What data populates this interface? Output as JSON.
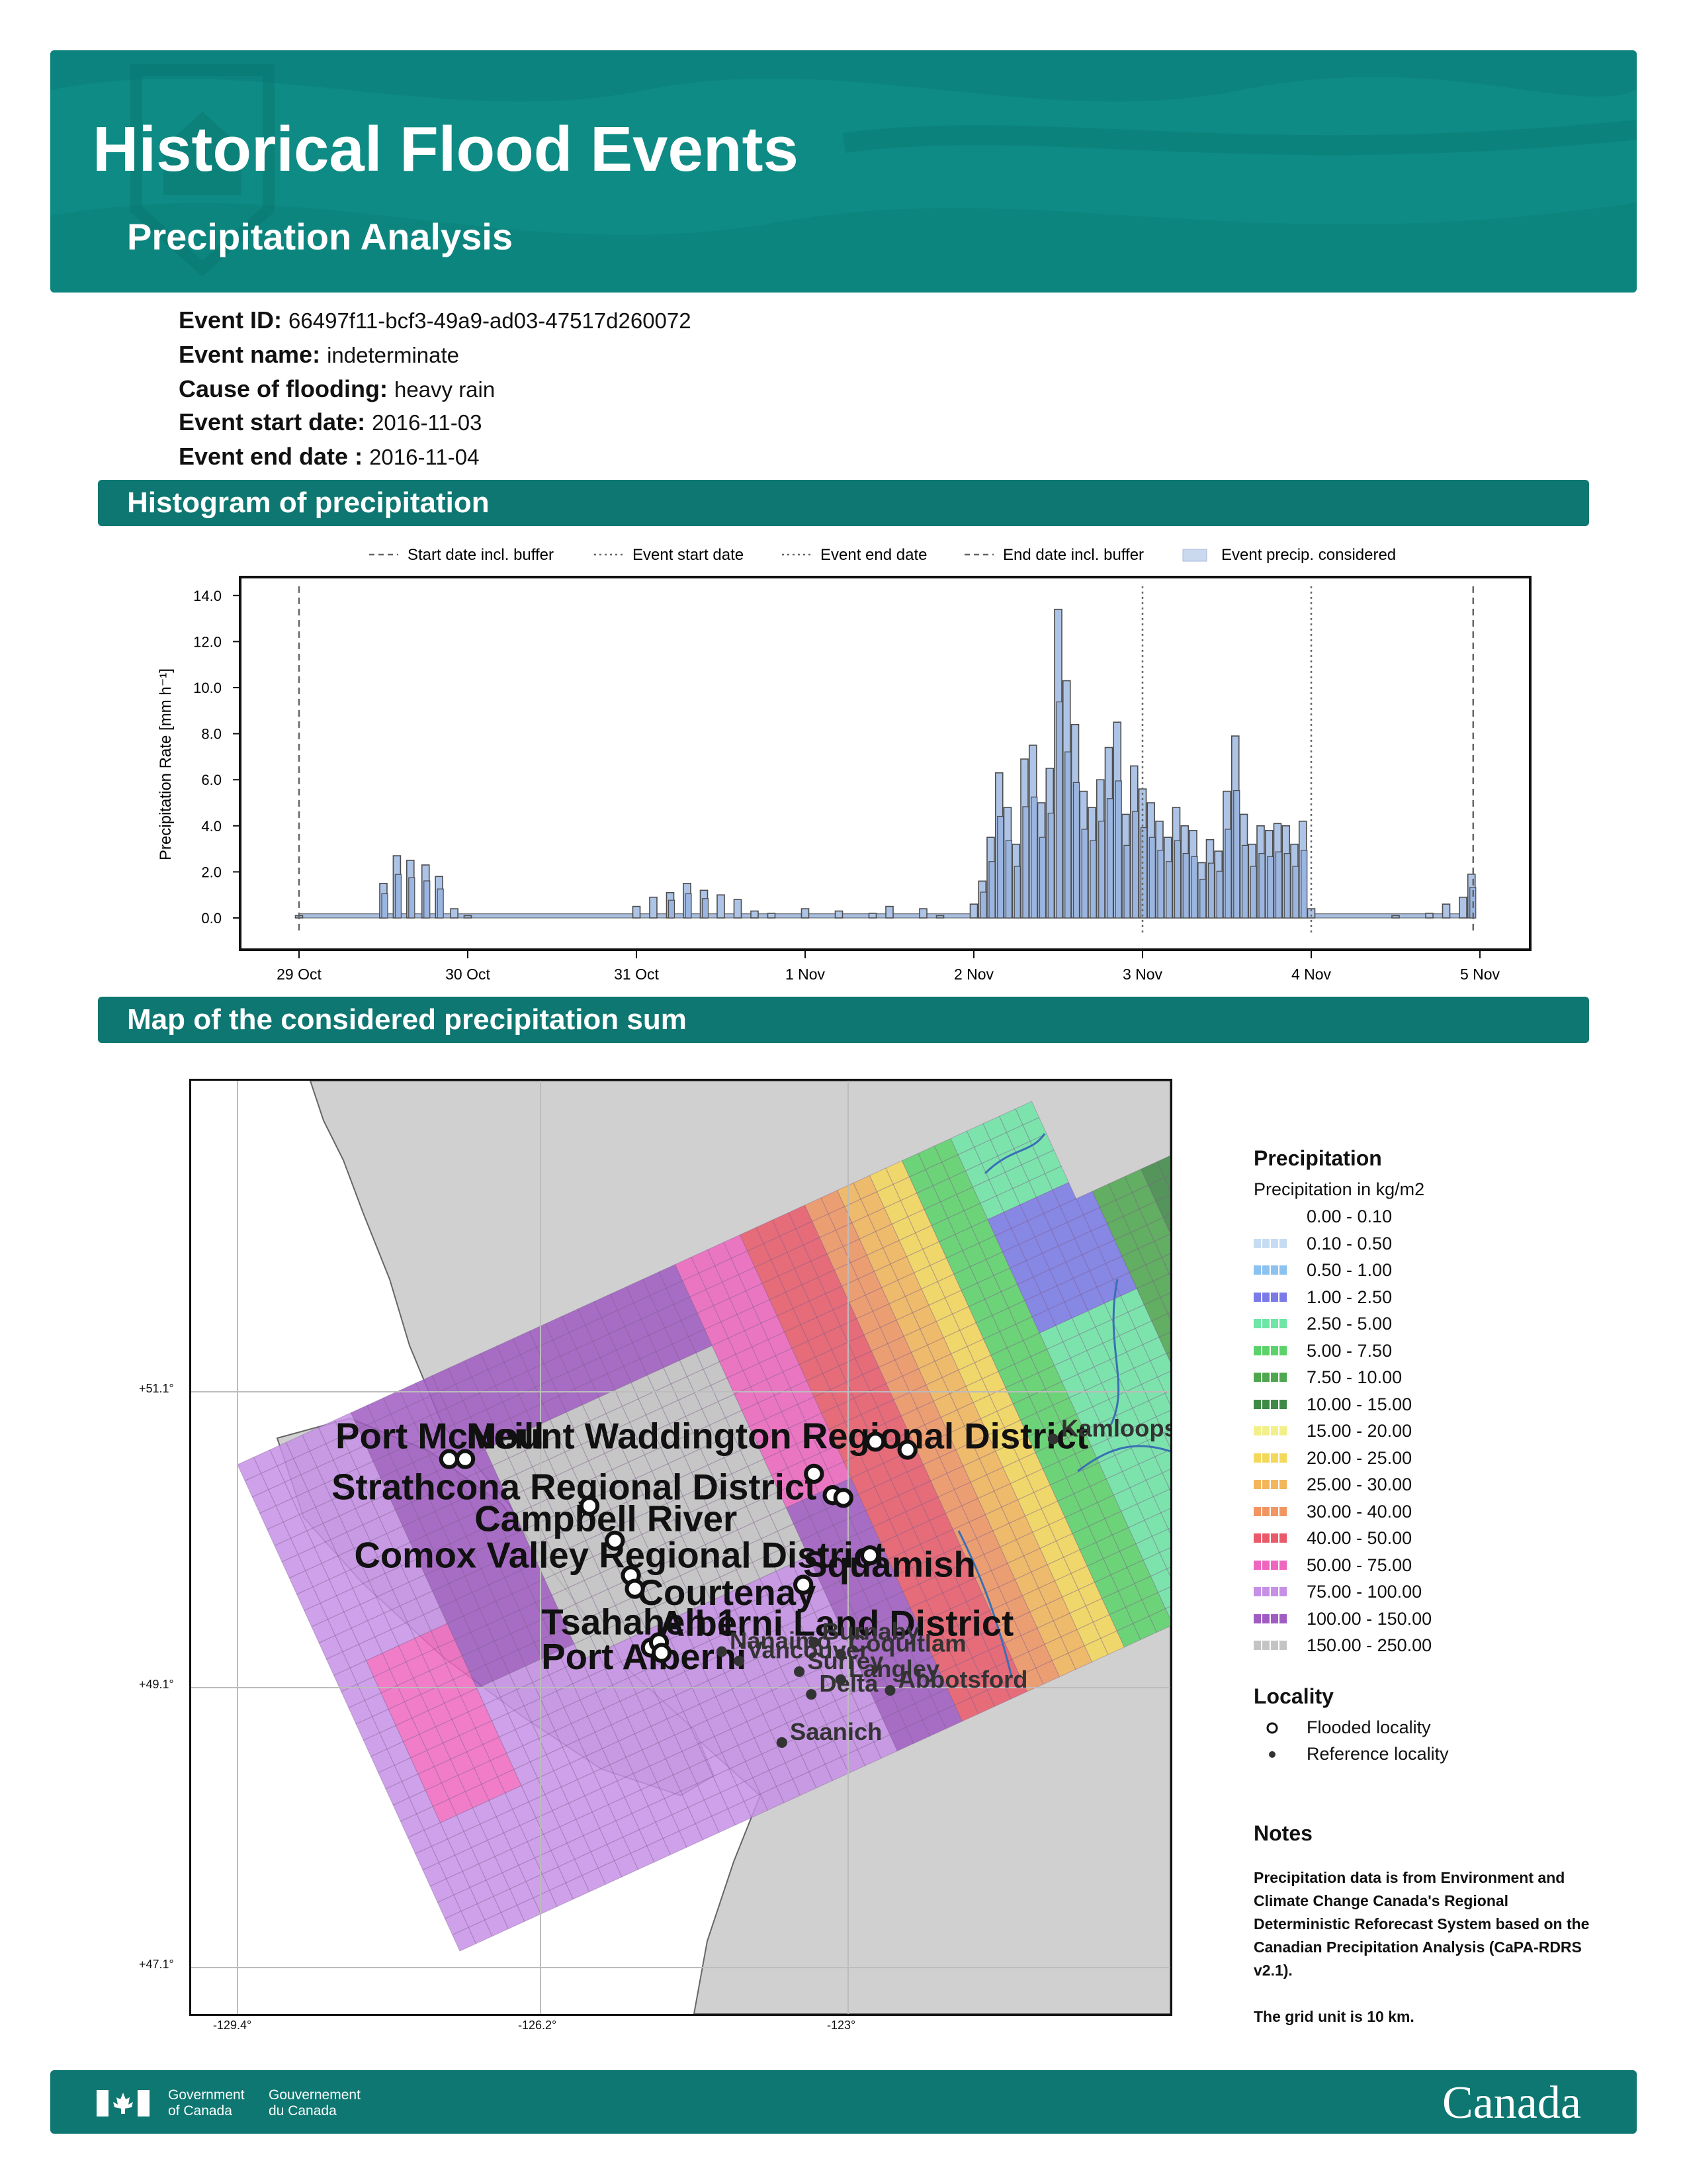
{
  "header": {
    "title": "Historical Flood Events",
    "subtitle": "Precipitation Analysis"
  },
  "event": {
    "id_label": "Event ID:",
    "id": "66497f11-bcf3-49a9-ad03-47517d260072",
    "name_label": "Event name:",
    "name": "indeterminate",
    "cause_label": "Cause of flooding:",
    "cause": "heavy rain",
    "start_label": "Event start date:",
    "start": "2016-11-03",
    "end_label": "Event end date :",
    "end": "2016-11-04"
  },
  "sections": {
    "histogram": "Histogram of precipitation",
    "map": "Map of the considered precipitation sum"
  },
  "chart_data": {
    "type": "bar",
    "title": "",
    "xlabel": "",
    "ylabel": "Precipitation Rate [mm h⁻¹]",
    "ylim": [
      -1.2,
      14.8
    ],
    "yticks": [
      "0.0",
      "2.0",
      "4.0",
      "6.0",
      "8.0",
      "10.0",
      "12.0",
      "14.0"
    ],
    "xticks": [
      "29 Oct",
      "30 Oct",
      "31 Oct",
      "1 Nov",
      "2 Nov",
      "3 Nov",
      "4 Nov",
      "5 Nov"
    ],
    "legend": {
      "placement": "top",
      "entries": [
        "Start date incl. buffer",
        "Event start date",
        "Event end date",
        "End date incl. buffer",
        "Event precip. considered"
      ]
    },
    "vlines": [
      {
        "name": "Start date incl. buffer",
        "x": 0.0,
        "style": "dashed"
      },
      {
        "name": "Event start date",
        "x": 5.0,
        "style": "dotted"
      },
      {
        "name": "Event end date",
        "x": 6.0,
        "style": "dotted"
      },
      {
        "name": "End date incl. buffer",
        "x": 6.96,
        "style": "dashed"
      }
    ],
    "x_unit": "days since 29 Oct",
    "series": [
      {
        "name": "Event precip. considered",
        "x": [
          0.0,
          0.5,
          0.5,
          0.58,
          0.66,
          0.75,
          0.83,
          0.92,
          1.0,
          2.0,
          2.1,
          2.2,
          2.3,
          2.4,
          2.5,
          2.6,
          2.7,
          2.8,
          3.0,
          3.2,
          3.4,
          3.5,
          3.7,
          3.8,
          4.0,
          4.05,
          4.1,
          4.15,
          4.2,
          4.25,
          4.3,
          4.35,
          4.4,
          4.45,
          4.5,
          4.55,
          4.6,
          4.65,
          4.7,
          4.75,
          4.8,
          4.85,
          4.9,
          4.95,
          5.0,
          5.05,
          5.1,
          5.15,
          5.2,
          5.25,
          5.3,
          5.35,
          5.4,
          5.45,
          5.5,
          5.55,
          5.6,
          5.65,
          5.7,
          5.75,
          5.8,
          5.85,
          5.9,
          5.95,
          6.0,
          6.5,
          6.7,
          6.8,
          6.9,
          6.95
        ],
        "values": [
          0.1,
          0.2,
          1.5,
          2.7,
          2.5,
          2.3,
          1.8,
          0.4,
          0.1,
          0.5,
          0.9,
          1.1,
          1.5,
          1.2,
          1.0,
          0.8,
          0.3,
          0.2,
          0.4,
          0.3,
          0.2,
          0.5,
          0.4,
          0.1,
          0.6,
          1.6,
          3.5,
          6.3,
          4.8,
          3.2,
          6.9,
          7.5,
          5.0,
          6.5,
          13.4,
          10.3,
          8.4,
          5.5,
          4.8,
          6.0,
          7.4,
          8.5,
          4.5,
          6.6,
          5.6,
          5.0,
          4.2,
          3.5,
          4.8,
          4.0,
          3.8,
          2.4,
          3.4,
          2.9,
          5.5,
          7.9,
          4.5,
          3.2,
          4.0,
          3.8,
          4.1,
          4.0,
          3.2,
          4.2,
          0.4,
          0.1,
          0.2,
          0.6,
          0.9,
          1.9
        ]
      }
    ]
  },
  "map": {
    "lat_ticks": [
      "+51.1°",
      "+49.1°",
      "+47.1°"
    ],
    "lon_ticks": [
      "-129.4°",
      "-126.2°",
      "-123°"
    ],
    "flooded_localities": [
      "Port McNeill",
      "Mount Waddington Regional District",
      "Strathcona Regional District",
      "Campbell River",
      "Comox Valley Regional District",
      "Squamish",
      "Courtenay",
      "Tsahaheh 1",
      "Alberni Land District",
      "Port Alberni"
    ],
    "reference_localities": [
      "Kamloops",
      "Nanaimo",
      "Vancouver",
      "Burnaby",
      "Coquitlam",
      "Surrey",
      "Langley",
      "Delta",
      "Abbotsford",
      "Saanich"
    ]
  },
  "precip_legend": {
    "title": "Precipitation",
    "subtitle": "Precipitation in kg/m2",
    "classes": [
      {
        "label": "0.00 - 0.10",
        "color": "#ffffff"
      },
      {
        "label": "0.10 - 0.50",
        "color": "#c6dcf2"
      },
      {
        "label": "0.50 - 1.00",
        "color": "#8cc2f0"
      },
      {
        "label": "1.00 - 2.50",
        "color": "#7a7ae8"
      },
      {
        "label": "2.50 - 5.00",
        "color": "#6ee6a6"
      },
      {
        "label": "5.00 - 7.50",
        "color": "#5cd36a"
      },
      {
        "label": "7.50 - 10.00",
        "color": "#4fa84f"
      },
      {
        "label": "10.00 - 15.00",
        "color": "#3f8a45"
      },
      {
        "label": "15.00 - 20.00",
        "color": "#f3f08a"
      },
      {
        "label": "20.00 - 25.00",
        "color": "#f4d85a"
      },
      {
        "label": "25.00 - 30.00",
        "color": "#f3b65a"
      },
      {
        "label": "30.00 - 40.00",
        "color": "#f19563"
      },
      {
        "label": "40.00 - 50.00",
        "color": "#ea5a6a"
      },
      {
        "label": "50.00 - 75.00",
        "color": "#ee66c0"
      },
      {
        "label": "75.00 - 100.00",
        "color": "#c590e6"
      },
      {
        "label": "100.00 - 150.00",
        "color": "#a05cc2"
      },
      {
        "label": "150.00 - 250.00",
        "color": "#c4c4c4"
      }
    ]
  },
  "locality_legend": {
    "title": "Locality",
    "flooded": "Flooded locality",
    "reference": "Reference locality"
  },
  "notes": {
    "title": "Notes",
    "body": "Precipitation data is from Environment and Climate Change Canada's Regional Deterministic Reforecast System based on the Canadian Precipitation Analysis (CaPA-RDRS v2.1).",
    "grid": "The grid unit is 10 km."
  },
  "footer": {
    "gov_en_1": "Government",
    "gov_en_2": "of Canada",
    "gov_fr_1": "Gouvernement",
    "gov_fr_2": "du Canada",
    "wordmark": "Canada"
  }
}
